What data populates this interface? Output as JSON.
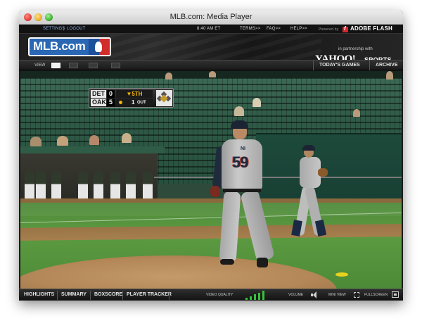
{
  "window": {
    "title": "MLB.com: Media Player"
  },
  "topbar": {
    "settings": "SETTINGS",
    "separator": "|",
    "logout": "LOGOUT",
    "time": "8:40 AM ET",
    "terms": "TERMS>>",
    "faq": "FAQ>>",
    "help": "HELP>>",
    "powered_by": "Powered by",
    "flash": "ADOBE FLASH"
  },
  "header": {
    "logo_text": "MLB.com",
    "partner_text": "in partnership with",
    "partner_brand": "YAHOO!",
    "partner_suffix": "SPORTS"
  },
  "viewbar": {
    "view_label": "VIEW",
    "active_mode": 1,
    "today_games": "TODAY'S GAMES",
    "archive": "ARCHIVE"
  },
  "scorebug": {
    "away_team": "DET",
    "away_score": "0",
    "home_team": "OAK",
    "home_score": "5",
    "inning": "▼5TH",
    "outs": "1",
    "outs_label": "OUT"
  },
  "video": {
    "pitcher_name": "NI",
    "pitcher_number": "59"
  },
  "controlbar": {
    "highlights": "HIGHLIGHTS",
    "summary": "SUMMARY",
    "boxscore": "BOXSCORE",
    "player_tracker": "PLAYER TRACKER",
    "video_quality": "VIDEO QUALITY",
    "quality_level": 5,
    "quality_max": 5,
    "volume": "VOLUME",
    "mini_view": "MINI VIEW",
    "fullscreen": "FULLSCREEN",
    "accent_color": "#37c23a"
  }
}
